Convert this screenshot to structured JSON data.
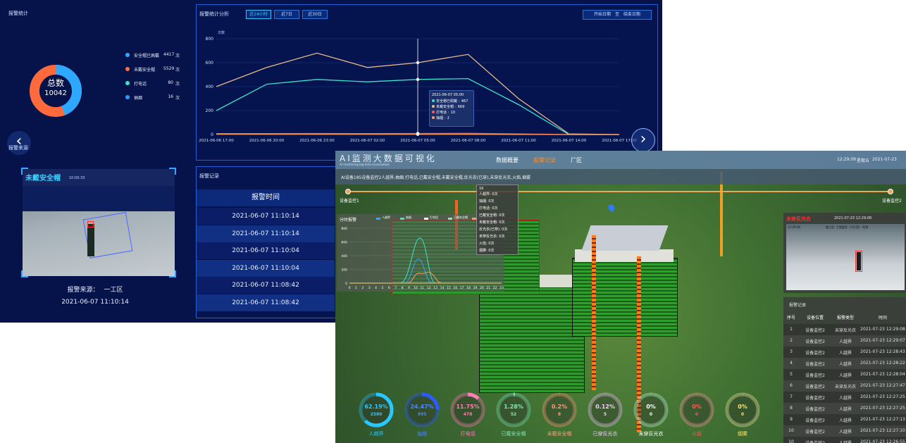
{
  "shot1": {
    "stats_panel": {
      "title": "报警统计",
      "donut_center": {
        "label": "总数",
        "value": "10042"
      },
      "legend": [
        {
          "label": "安全帽已佩戴",
          "value": "4417",
          "unit": "次",
          "color": "#2fa8ff"
        },
        {
          "label": "未戴安全帽",
          "value": "5529",
          "unit": "次",
          "color": "#ff7043"
        },
        {
          "label": "打电话",
          "value": "80",
          "unit": "次",
          "color": "#3ee2c9"
        },
        {
          "label": "抽烟",
          "value": "16",
          "unit": "次",
          "color": "#2d9bff"
        }
      ]
    },
    "source_panel": {
      "title": "报警来源",
      "badge": "未戴安全帽",
      "source_label": "报警来源：",
      "source_value": "一工区",
      "time": "2021-06-07 11:10:14",
      "cam_time": "10:00:33"
    },
    "chart_panel": {
      "title": "报警统计分析",
      "tabs": [
        "近24小时",
        "近7日",
        "近30日"
      ],
      "active_tab": 0,
      "date_start": "开始日期",
      "date_sep": "至",
      "date_end": "结束日期",
      "y_unit": "次数",
      "tooltip": {
        "title": "2021-06-07 05:00",
        "items": [
          {
            "label": "安全帽已佩戴",
            "value": "467",
            "color": "#3ee2c9"
          },
          {
            "label": "未戴安全帽",
            "value": "669",
            "color": "#e6b98a"
          },
          {
            "label": "打电话",
            "value": "10",
            "color": "#ff5a5a"
          },
          {
            "label": "抽烟",
            "value": "2",
            "color": "#ff9b5a"
          }
        ]
      }
    },
    "records_panel": {
      "title": "报警记录",
      "column": "报警时间",
      "rows": [
        "2021-06-07 11:10:14",
        "2021-06-07 11:10:14",
        "2021-06-07 11:10:04",
        "2021-06-07 11:10:04",
        "2021-06-07 11:08:42",
        "2021-06-07 11:08:42"
      ]
    },
    "nav": {
      "prev": "‹",
      "next": "›"
    }
  },
  "chart_data": {
    "type": "line",
    "title": "",
    "xlabel": "",
    "ylabel": "次数",
    "ylim": [
      0,
      800
    ],
    "yticks": [
      0,
      200,
      400,
      600,
      800
    ],
    "x": [
      "2021-06-06 17:00",
      "2021-06-06 20:00",
      "2021-06-06 23:00",
      "2021-06-07 02:00",
      "2021-06-07 05:00",
      "2021-06-07 08:00",
      "2021-06-07 11:00",
      "2021-06-07 14:00",
      "2021-06-07 17:00"
    ],
    "series": [
      {
        "name": "未戴安全帽",
        "color": "#e6b98a",
        "values": [
          400,
          560,
          680,
          560,
          600,
          669,
          300,
          5,
          0
        ]
      },
      {
        "name": "安全帽已佩戴",
        "color": "#3ee2c9",
        "values": [
          200,
          420,
          460,
          440,
          460,
          467,
          250,
          0,
          0
        ]
      },
      {
        "name": "打电话",
        "color": "#ff5a5a",
        "values": [
          8,
          8,
          9,
          8,
          9,
          10,
          5,
          0,
          0
        ]
      },
      {
        "name": "抽烟",
        "color": "#ff9b5a",
        "values": [
          2,
          2,
          2,
          2,
          2,
          2,
          1,
          0,
          0
        ]
      }
    ]
  },
  "shot2": {
    "header": {
      "title": "AI监测大数据可视化",
      "subtitle": "AI monitoring big data visualization",
      "tabs": [
        "数据概要",
        "报警记录",
        "厂区"
      ],
      "active_tab": 1,
      "time": "12:29:09",
      "weekday": "星期五",
      "date": "2021-07-23"
    },
    "ticker": "AI设备185设备监控2人越界,抽烟,打电话,已戴安全帽,未戴安全帽,反光衣(已穿),未穿反光衣,火焰,烟雾",
    "slider": {
      "left": "设备监控1",
      "right": "设备监控2"
    },
    "hover_tip": {
      "head": "16",
      "items": [
        "人越界: 0次",
        "抽烟: 0次",
        "打电话: 0次",
        "已戴安全帽: 0次",
        "未戴安全帽: 0次",
        "反光衣(已穿): 0次",
        "未穿反光衣: 0次",
        "火焰: 0次",
        "烟雾: 0次"
      ]
    },
    "mini_chart": {
      "title": "分时报警",
      "legend": [
        "人越界",
        "抽烟",
        "打电话",
        "已戴安全帽",
        "未戴安全帽"
      ],
      "yticks": [
        "0",
        "200",
        "400",
        "600",
        "800"
      ],
      "xticks": [
        "0",
        "1",
        "2",
        "3",
        "4",
        "5",
        "6",
        "7",
        "8",
        "9",
        "10",
        "11",
        "12",
        "13",
        "14",
        "15",
        "16",
        "17",
        "18",
        "19",
        "20",
        "21",
        "22",
        "23"
      ]
    },
    "alert": {
      "badge": "未穿反光衣",
      "time": "2021-07-23 12:29:08",
      "cam_time": "12:29:08",
      "cam_label": "施工区: 工地监控 - 1号(西) - 检测"
    },
    "records": {
      "title": "报警记录",
      "columns": [
        "序号",
        "设备位置",
        "报警类型",
        "时间"
      ],
      "rows": [
        [
          "1",
          "设备监控2",
          "未穿反光衣",
          "2021-07-23 12:29:08"
        ],
        [
          "2",
          "设备监控2",
          "人越界",
          "2021-07-23 12:29:07"
        ],
        [
          "3",
          "设备监控2",
          "人越界",
          "2021-07-23 12:28:43"
        ],
        [
          "4",
          "设备监控2",
          "人越界",
          "2021-07-23 12:28:22"
        ],
        [
          "5",
          "设备监控2",
          "人越界",
          "2021-07-23 12:28:04"
        ],
        [
          "6",
          "设备监控2",
          "未穿反光衣",
          "2021-07-23 12:27:47"
        ],
        [
          "7",
          "设备监控2",
          "人越界",
          "2021-07-23 12:27:25"
        ],
        [
          "8",
          "设备监控2",
          "人越界",
          "2021-07-23 12:27:25"
        ],
        [
          "9",
          "设备监控2",
          "人越界",
          "2021-07-23 12:27:13"
        ],
        [
          "10",
          "设备监控2",
          "人越界",
          "2021-07-23 12:27:10"
        ],
        [
          "10",
          "设备监控2",
          "人越界",
          "2021-07-23 12:26:55"
        ]
      ]
    },
    "gauges": [
      {
        "label": "人越界",
        "percent": "62.19%",
        "count": "2580",
        "ratio": 0.6219,
        "color": "#29c7ff",
        "text_color": "#29c7ff"
      },
      {
        "label": "抽烟",
        "percent": "24.47%",
        "count": "995",
        "ratio": 0.2447,
        "color": "#2d5bff",
        "text_color": "#4b86ff"
      },
      {
        "label": "打电话",
        "percent": "11.75%",
        "count": "478",
        "ratio": 0.1175,
        "color": "#ff7eb4",
        "text_color": "#ff7eb4"
      },
      {
        "label": "已戴安全帽",
        "percent": "1.28%",
        "count": "52",
        "ratio": 0.0128,
        "color": "#7fe9b8",
        "text_color": "#7fe9b8"
      },
      {
        "label": "未戴安全帽",
        "percent": "0.2%",
        "count": "8",
        "ratio": 0.002,
        "color": "#ff9c7a",
        "text_color": "#ff9c7a"
      },
      {
        "label": "已穿反光衣",
        "percent": "0.12%",
        "count": "5",
        "ratio": 0.0012,
        "color": "#f3c9ff",
        "text_color": "#f3c9ff"
      },
      {
        "label": "未穿反光衣",
        "percent": "0%",
        "count": "0",
        "ratio": 0,
        "color": "#bfffe0",
        "text_color": "#ffffff"
      },
      {
        "label": "火焰",
        "percent": "0%",
        "count": "0",
        "ratio": 0,
        "color": "#ff9aa0",
        "text_color": "#ff5a5a"
      },
      {
        "label": "烟雾",
        "percent": "0%",
        "count": "0",
        "ratio": 0,
        "color": "#fff1a8",
        "text_color": "#ffe36b"
      }
    ]
  }
}
